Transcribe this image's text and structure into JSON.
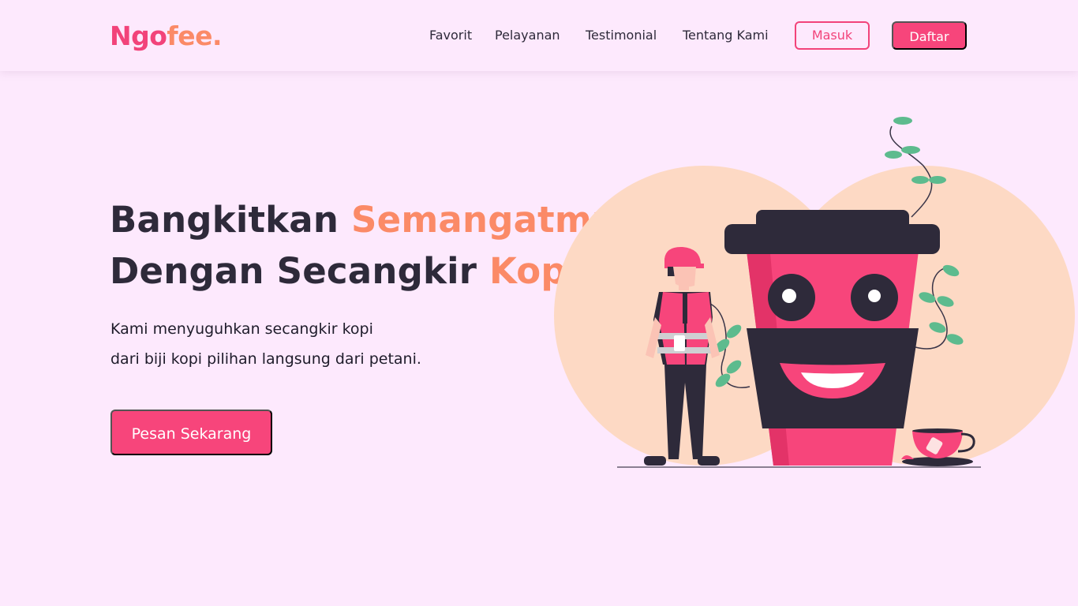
{
  "brand": {
    "logo_part1": "Ngo",
    "logo_part2": "fee."
  },
  "nav": {
    "links": [
      "Favorit",
      "Pelayanan",
      "Testimonial",
      "Tentang Kami"
    ],
    "login_label": "Masuk",
    "register_label": "Daftar"
  },
  "hero": {
    "title_line1_a": "Bangkitkan ",
    "title_line1_b": "Semangatmu",
    "title_line2_a": "Dengan Secangkir ",
    "title_line2_b": "Kopi",
    "desc_line1": "Kami menyuguhkan secangkir kopi",
    "desc_line2": "dari biji kopi pilihan langsung dari petani.",
    "cta_label": "Pesan Sekarang"
  },
  "colors": {
    "background": "#fde9fd",
    "primary": "#f7457b",
    "accent": "#fb8a67",
    "text": "#2e2a3a",
    "illustration_circle": "#fdd9c4",
    "leaf": "#5dbb8e"
  }
}
